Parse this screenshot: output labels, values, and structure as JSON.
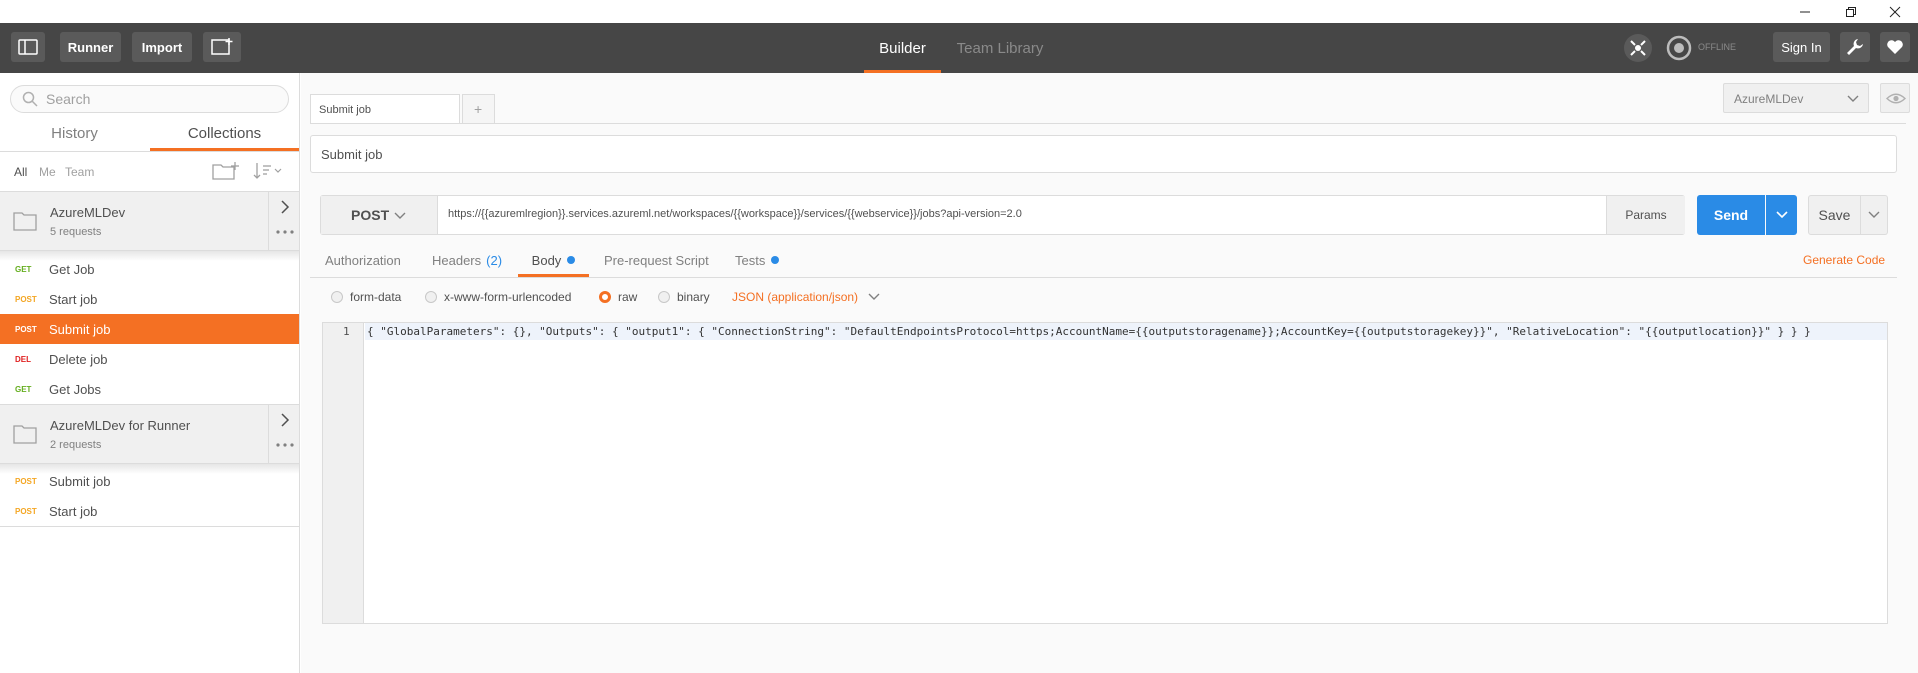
{
  "header": {
    "runner_label": "Runner",
    "import_label": "Import",
    "builder_tab": "Builder",
    "team_library_tab": "Team Library",
    "offline_label": "OFFLINE",
    "sign_in_label": "Sign In",
    "accent_color": "#f47023"
  },
  "sidebar": {
    "search_placeholder": "Search",
    "tabs": [
      "History",
      "Collections"
    ],
    "filters": [
      "All",
      "Me",
      "Team"
    ],
    "collections": [
      {
        "name": "AzureMLDev",
        "count": "5 requests",
        "requests": [
          {
            "method": "GET",
            "name": "Get Job",
            "color": "#65ae1f"
          },
          {
            "method": "POST",
            "name": "Start job",
            "color": "#f4a623"
          },
          {
            "method": "POST",
            "name": "Submit job",
            "color": "#ffffff"
          },
          {
            "method": "DEL",
            "name": "Delete job",
            "color": "#e02020"
          },
          {
            "method": "GET",
            "name": "Get Jobs",
            "color": "#65ae1f"
          }
        ]
      },
      {
        "name": "AzureMLDev for Runner",
        "count": "2 requests",
        "requests": [
          {
            "method": "POST",
            "name": "Submit job",
            "color": "#f4a623"
          },
          {
            "method": "POST",
            "name": "Start job",
            "color": "#f4a623"
          }
        ]
      }
    ]
  },
  "main": {
    "tab_label": "Submit job",
    "new_tab_label": "+",
    "environment": "AzureMLDev",
    "request_name": "Submit job",
    "method": "POST",
    "url": "https://{{azuremlregion}}.services.azureml.net/workspaces/{{workspace}}/services/{{webservice}}/jobs?api-version=2.0",
    "params_label": "Params",
    "send_label": "Send",
    "save_label": "Save",
    "subtabs": {
      "authorization": "Authorization",
      "headers": "Headers",
      "headers_count": "(2)",
      "body": "Body",
      "prerequest": "Pre-request Script",
      "tests": "Tests"
    },
    "generate_code": "Generate Code",
    "body_modes": [
      "form-data",
      "x-www-form-urlencoded",
      "raw",
      "binary"
    ],
    "content_type": "JSON (application/json)",
    "editor": {
      "line_number": "1",
      "code": "{ \"GlobalParameters\": {}, \"Outputs\": { \"output1\": { \"ConnectionString\": \"DefaultEndpointsProtocol=https;AccountName={{outputstoragename}};AccountKey={{outputstoragekey}}\", \"RelativeLocation\": \"{{outputlocation}}\" } } }"
    }
  }
}
